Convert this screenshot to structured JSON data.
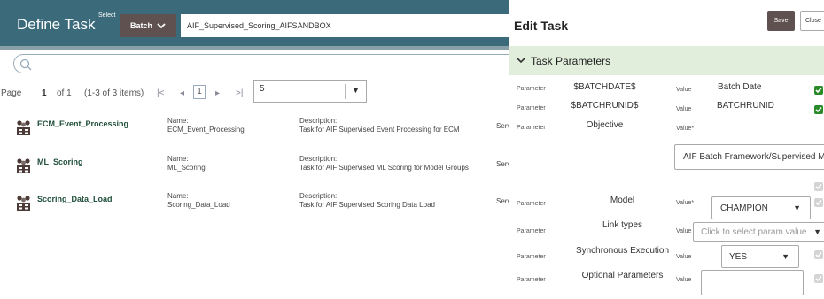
{
  "left": {
    "title": "Define Task",
    "select_label": "Select",
    "batch_button": "Batch",
    "batch_value": "AIF_Supervised_Scoring_AIFSANDBOX",
    "pager": {
      "page_label": "Page",
      "page_num": "1",
      "of": "of 1",
      "items": "(1-3 of 3 items)",
      "first": "|<",
      "prev": "◂",
      "current": "1",
      "next": "▸",
      "last": ">|",
      "per_page": "5"
    },
    "rows": [
      {
        "title": "ECM_Event_Processing",
        "name_label": "Name:",
        "name": "ECM_Event_Processing",
        "desc_label": "Description:",
        "desc": "Task for AIF Supervised Event Processing for ECM",
        "serv": "Serv"
      },
      {
        "title": "ML_Scoring",
        "name_label": "Name:",
        "name": "ML_Scoring",
        "desc_label": "Description:",
        "desc": "Task for AIF Supervised ML Scoring for Model Groups",
        "serv": "Serv"
      },
      {
        "title": "Scoring_Data_Load",
        "name_label": "Name:",
        "name": "Scoring_Data_Load",
        "desc_label": "Description:",
        "desc": "Task for AIF Supervised Scoring Data Load",
        "serv": "Serv"
      }
    ]
  },
  "edit": {
    "title": "Edit Task",
    "save": "Save",
    "close": "Close",
    "section": "Task Parameters",
    "param_label": "Parameter",
    "value_label": "Value",
    "value_req_label": "Value*",
    "params": {
      "batchdate": {
        "name": "$BATCHDATE$",
        "value": "Batch Date"
      },
      "batchrunid": {
        "name": "$BATCHRUNID$",
        "value": "BATCHRUNID"
      },
      "objective": {
        "name": "Objective",
        "value": "AIF Batch Framework/Supervised ML/Ev"
      },
      "model": {
        "name": "Model",
        "value": "CHAMPION"
      },
      "link": {
        "name": "Link types",
        "placeholder": "Click to select param value"
      },
      "sync": {
        "name": "Synchronous Execution",
        "value": "YES"
      },
      "optional": {
        "name": "Optional Parameters",
        "value": ""
      }
    }
  },
  "colors": {
    "header": "#3b6b7b",
    "accent_button": "#5e5150",
    "section_bg": "#e1eedb",
    "check_on": "#2a8a2a"
  }
}
